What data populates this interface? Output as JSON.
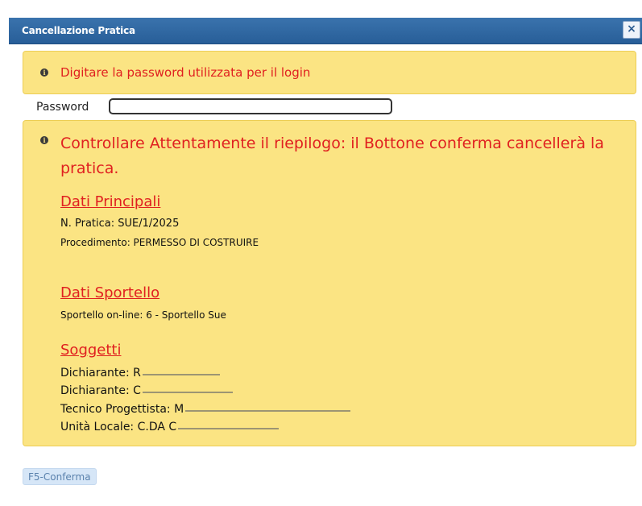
{
  "dialog": {
    "title": "Cancellazione Pratica",
    "close_label": "×"
  },
  "password_notice": {
    "icon": "info-icon",
    "message": "Digitare la password utilizzata per il login"
  },
  "password_field": {
    "label": "Password",
    "value": "",
    "placeholder": ""
  },
  "summary": {
    "icon": "info-icon",
    "warning": "Controllare Attentamente il riepilogo: il Bottone conferma cancellerà la pratica.",
    "dati_principali": {
      "title": "Dati Principali",
      "numero": "N. Pratica: SUE/1/2025",
      "procedimento": "Procedimento: PERMESSO DI COSTRUIRE"
    },
    "dati_sportello": {
      "title": "Dati Sportello",
      "sportello": "Sportello on-line: 6 - Sportello Sue"
    },
    "soggetti": {
      "title": "Soggetti",
      "items": [
        "Dichiarante: R",
        "Dichiarante: C",
        "Tecnico Progettista: M",
        "Unità Locale: C.DA  C"
      ]
    }
  },
  "footer": {
    "confirm_label": "F5-Conferma"
  },
  "colors": {
    "titlebar": "#285e98",
    "notice_bg": "#fbe483",
    "alert_text": "#e02020",
    "button_bg": "#d6e6f7"
  }
}
